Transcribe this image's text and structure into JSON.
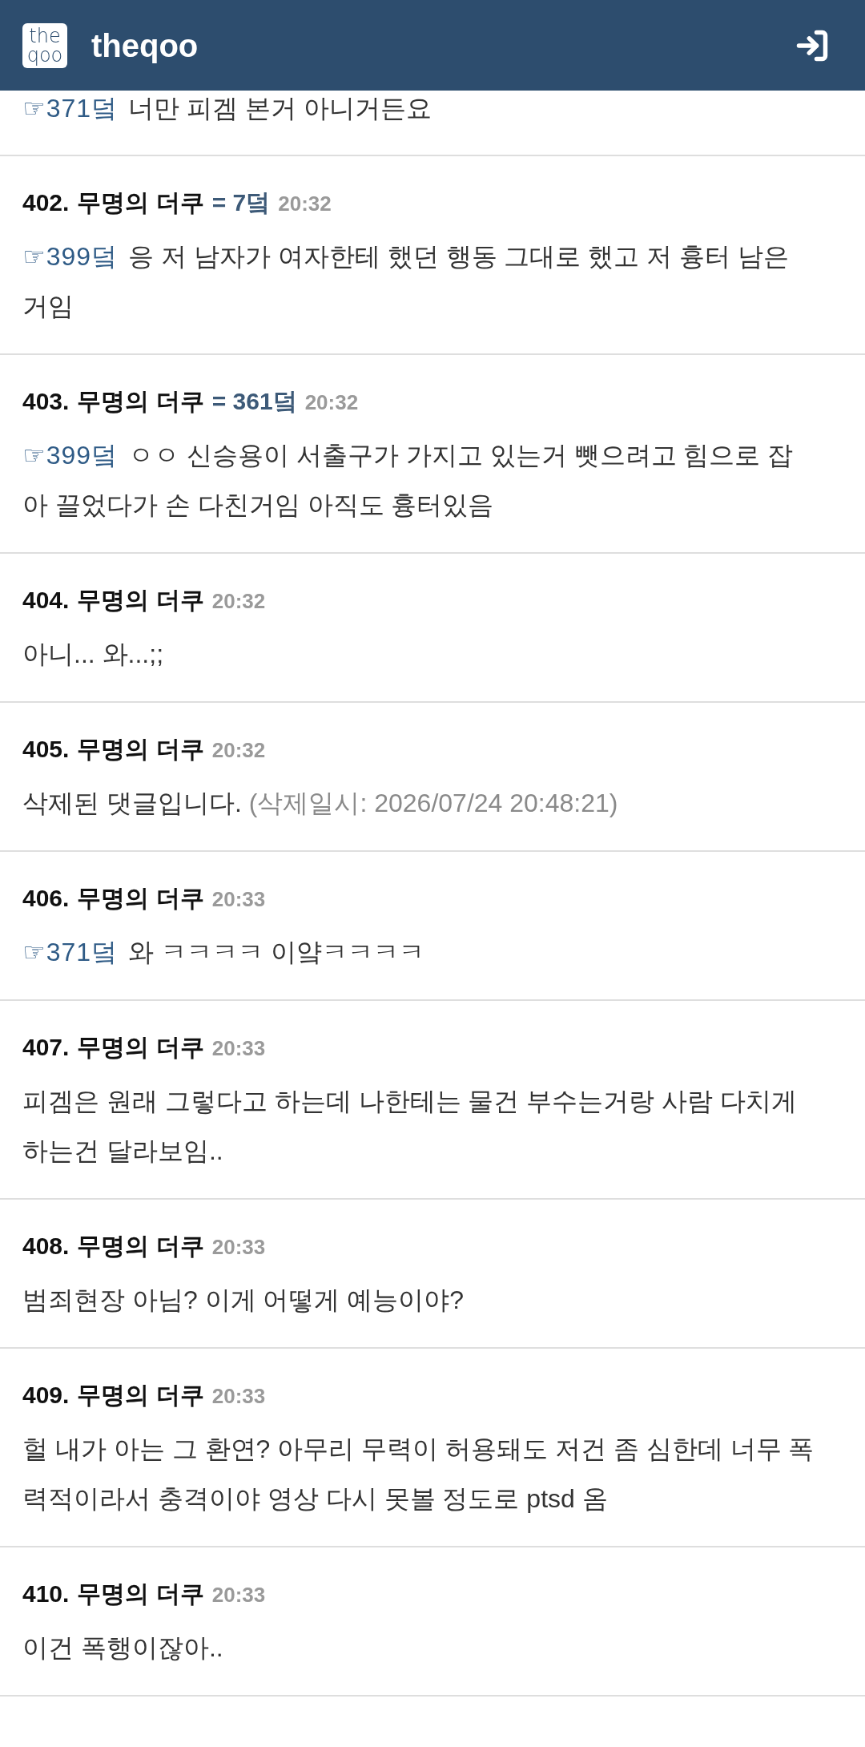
{
  "header": {
    "logo": {
      "line_1": "the",
      "line_2": "qoo"
    },
    "title": "theqoo"
  },
  "comments": [
    {
      "reply_to": "☞371덬",
      "text": "너만 피겜 본거 아니거든요"
    },
    {
      "number": "402.",
      "author": "무명의 더쿠",
      "ref": "= 7덬",
      "time": "20:32",
      "reply_to": "☞399덬",
      "text": "응 저 남자가 여자한테 했던 행동 그대로 했고 저 흉터 남은 거임"
    },
    {
      "number": "403.",
      "author": "무명의 더쿠",
      "ref": "= 361덬",
      "time": "20:32",
      "reply_to": "☞399덬",
      "text": "ㅇㅇ 신승용이 서출구가 가지고 있는거 뺏으려고 힘으로 잡아 끌었다가 손 다친거임 아직도 흉터있음"
    },
    {
      "number": "404.",
      "author": "무명의 더쿠",
      "time": "20:32",
      "text": "아니... 와...;;"
    },
    {
      "number": "405.",
      "author": "무명의 더쿠",
      "time": "20:32",
      "text": "삭제된 댓글입니다.",
      "note": "(삭제일시: 2026/07/24 20:48:21)"
    },
    {
      "number": "406.",
      "author": "무명의 더쿠",
      "time": "20:33",
      "reply_to": "☞371덬",
      "text": "와 ㅋㅋㅋㅋ 이얔ㅋㅋㅋㅋ"
    },
    {
      "number": "407.",
      "author": "무명의 더쿠",
      "time": "20:33",
      "text": "피겜은 원래 그렇다고 하는데 나한테는 물건 부수는거랑 사람 다치게 하는건 달라보임.."
    },
    {
      "number": "408.",
      "author": "무명의 더쿠",
      "time": "20:33",
      "text": "범죄현장 아님? 이게 어떻게 예능이야?"
    },
    {
      "number": "409.",
      "author": "무명의 더쿠",
      "time": "20:33",
      "text": "헐 내가 아는 그 환연? 아무리 무력이 허용돼도 저건 좀 심한데 너무 폭력적이라서 충격이야 영상 다시 못볼 정도로 ptsd 옴"
    },
    {
      "number": "410.",
      "author": "무명의 더쿠",
      "time": "20:33",
      "text": "이건 폭행이잖아.."
    }
  ]
}
